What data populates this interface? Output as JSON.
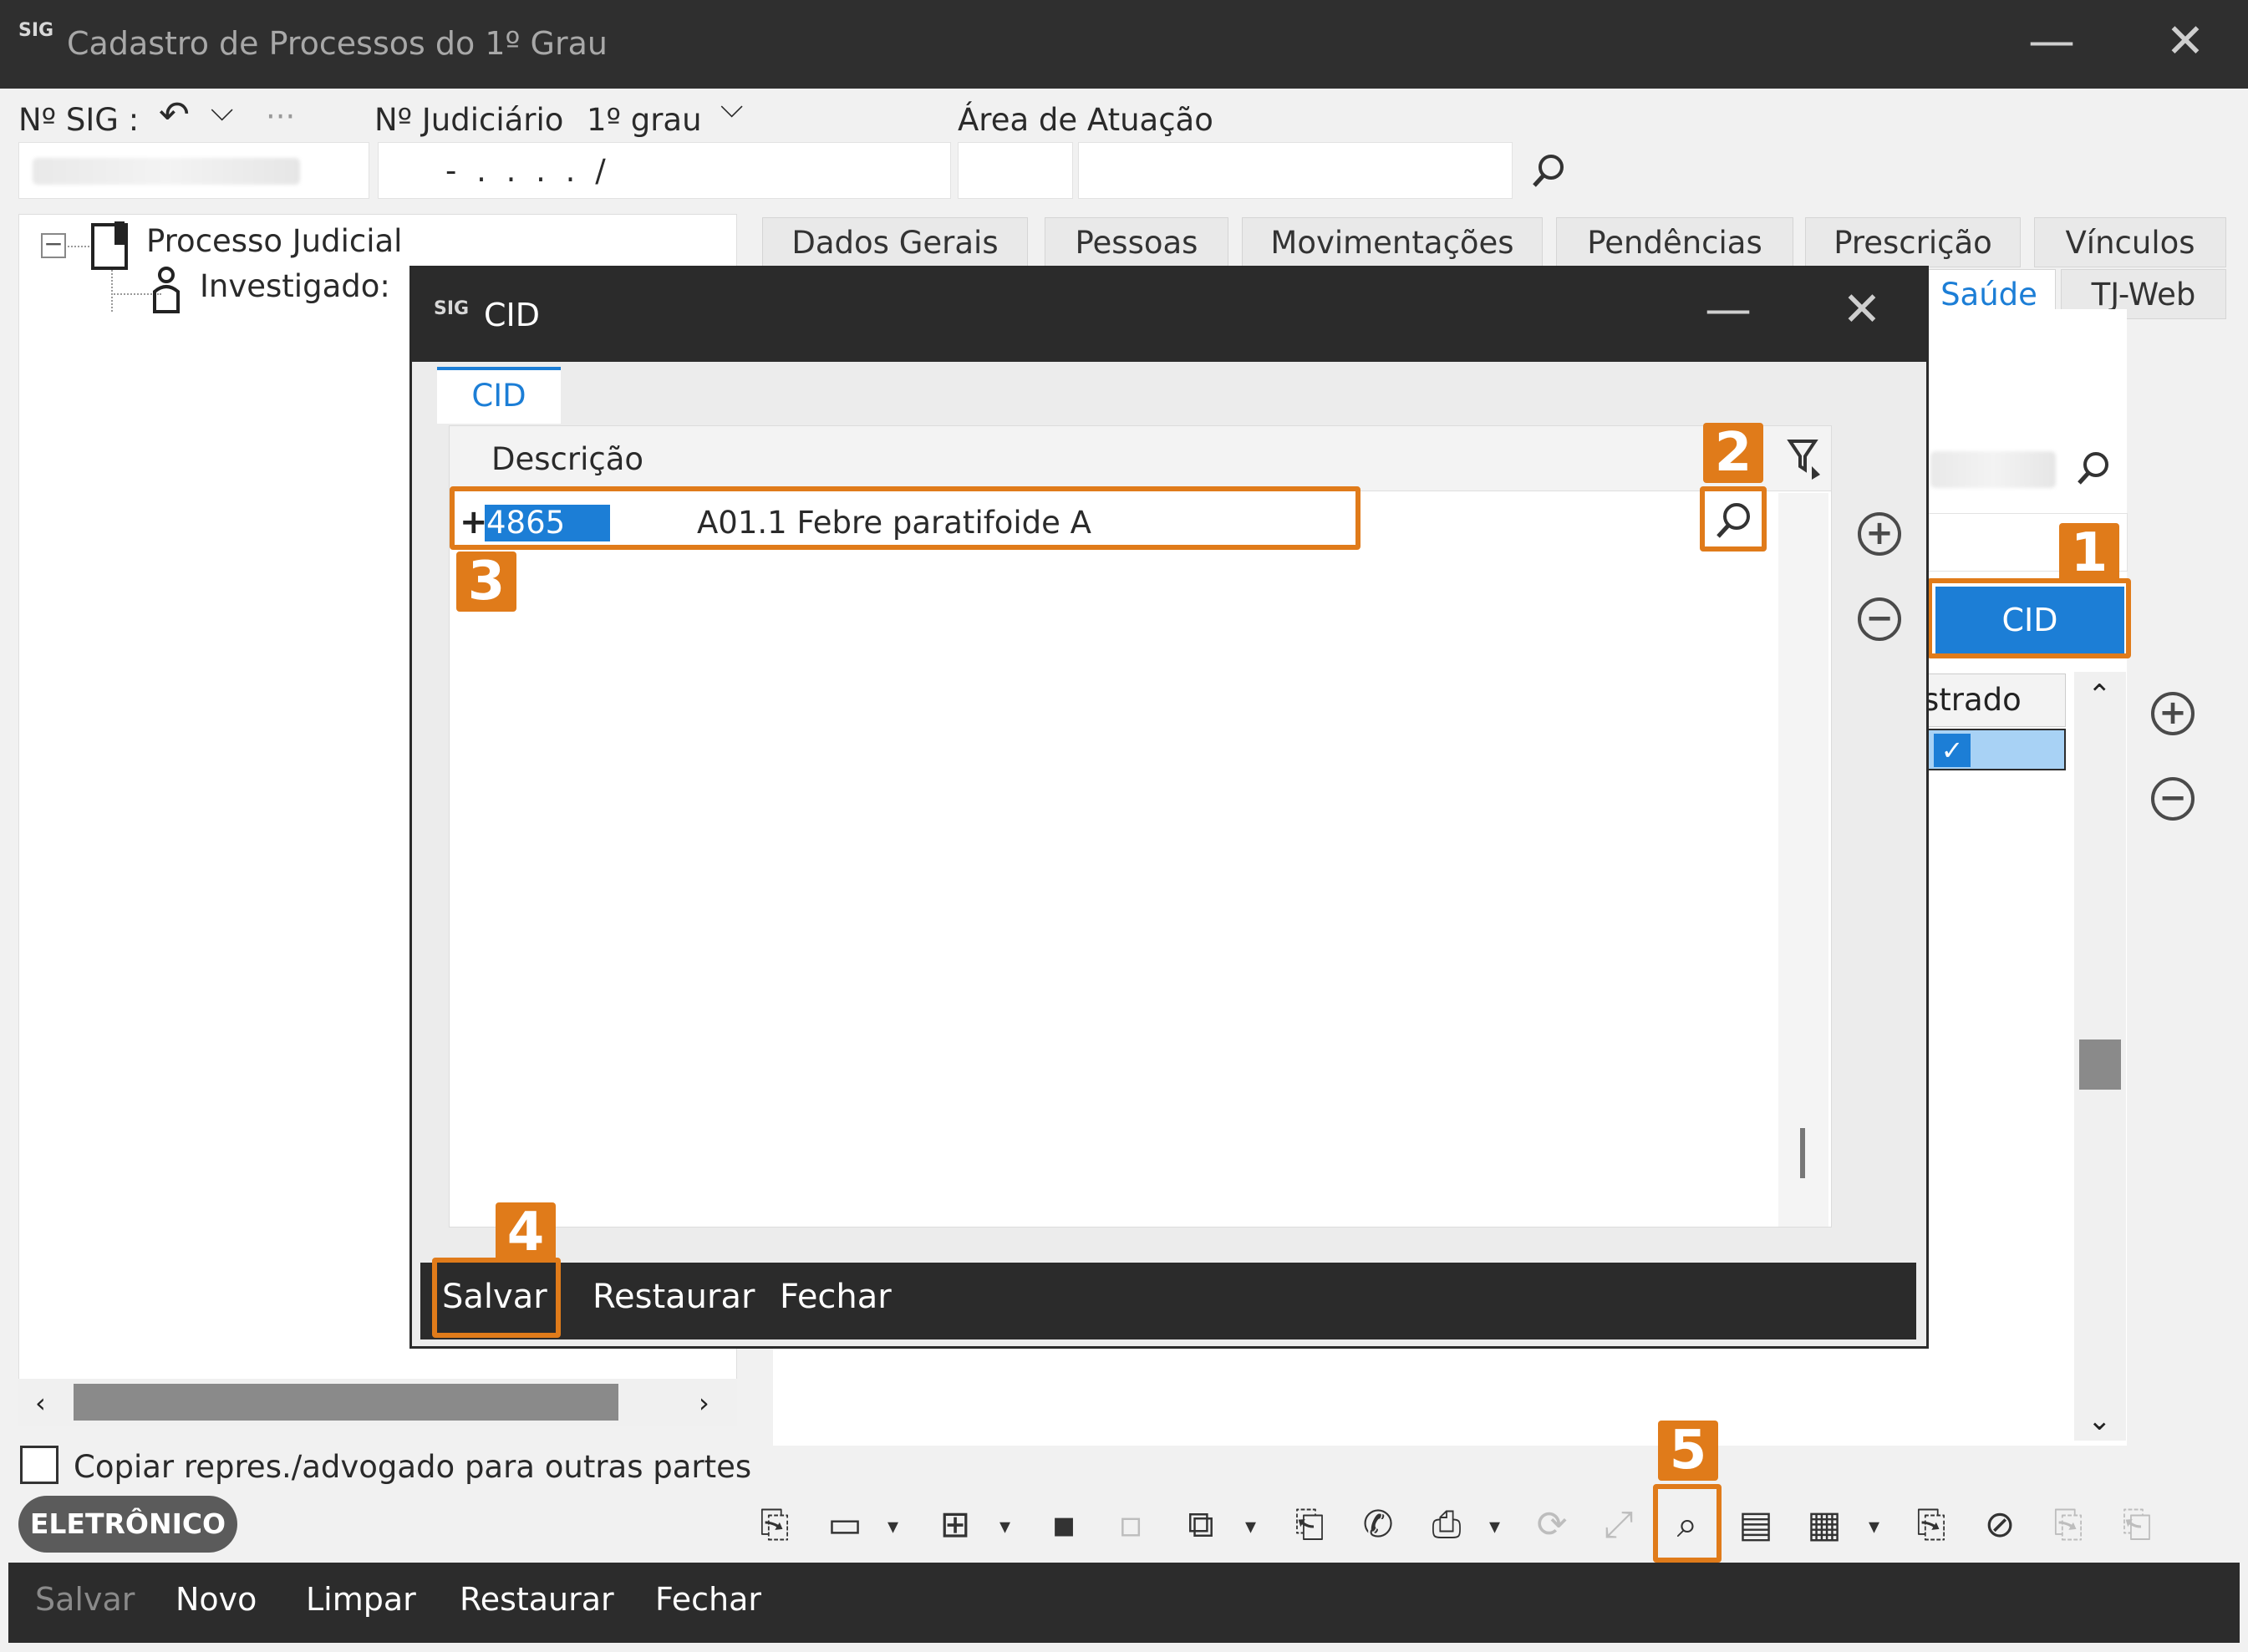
{
  "window": {
    "title": "Cadastro de Processos do 1º Grau",
    "logo": "SIG",
    "minimize": "—",
    "close": "✕"
  },
  "header": {
    "sig_label": "Nº SIG :",
    "sig_dots": "···",
    "judiciario_label": "Nº Judiciário",
    "grau_label": "1º grau",
    "judiciario_value": "- .   . . .   /",
    "area_label": "Área de Atuação"
  },
  "tree": {
    "root_label": "Processo Judicial",
    "child_label": "Investigado:"
  },
  "tabs_row1": [
    "Dados Gerais",
    "Pessoas",
    "Movimentações",
    "Pendências",
    "Prescrição",
    "Vínculos"
  ],
  "tabs_row2": [
    "Saúde",
    "TJ-Web"
  ],
  "right_panel": {
    "cid_button": "CID",
    "column_partial": "strado"
  },
  "copy_checkbox_label": "Copiar repres./advogado para outras partes",
  "badge": "ELETRÔNICO",
  "bottom_bar": [
    "Salvar",
    "Novo",
    "Limpar",
    "Restaurar",
    "Fechar"
  ],
  "dialog": {
    "logo": "SIG",
    "title": "CID",
    "minimize": "—",
    "close": "✕",
    "tab": "CID",
    "grid": {
      "column": "Descrição",
      "row": {
        "expand": "+",
        "code": "4865",
        "description": "A01.1 Febre paratifoide A"
      }
    },
    "footer": [
      "Salvar",
      "Restaurar",
      "Fechar"
    ]
  },
  "annotations": [
    "1",
    "2",
    "3",
    "4",
    "5"
  ],
  "colors": {
    "accent": "#1c7ed6",
    "highlight": "#e07b1a",
    "titlebar": "#2f2f2f"
  }
}
